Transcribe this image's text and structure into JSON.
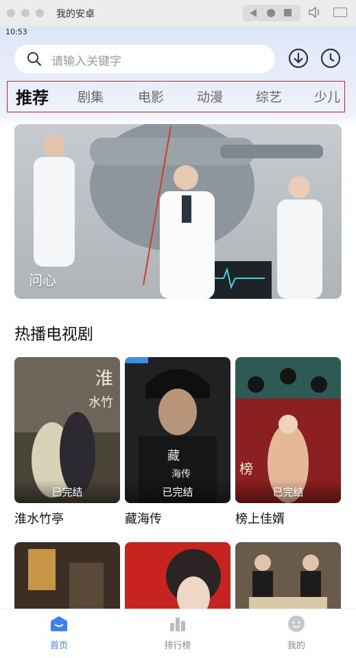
{
  "window": {
    "title": "我的安卓"
  },
  "status": {
    "time": "10:53"
  },
  "search": {
    "placeholder": "请输入关键字"
  },
  "tabs": [
    {
      "label": "推荐",
      "active": true
    },
    {
      "label": "剧集"
    },
    {
      "label": "电影"
    },
    {
      "label": "动漫"
    },
    {
      "label": "综艺"
    },
    {
      "label": "少儿"
    }
  ],
  "banner": {
    "title": "问心"
  },
  "section": {
    "title": "热播电视剧"
  },
  "cards": [
    {
      "title": "淮水竹亭",
      "status": "已完结"
    },
    {
      "title": "藏海传",
      "status": "已完结"
    },
    {
      "title": "榜上佳婿",
      "status": "已完结"
    }
  ],
  "nav": [
    {
      "label": "首页",
      "icon": "home-icon",
      "active": true
    },
    {
      "label": "排行榜",
      "icon": "ranking-icon"
    },
    {
      "label": "我的",
      "icon": "profile-icon"
    }
  ],
  "colors": {
    "accent": "#3f7ff5",
    "highlight": "#e0201c"
  }
}
